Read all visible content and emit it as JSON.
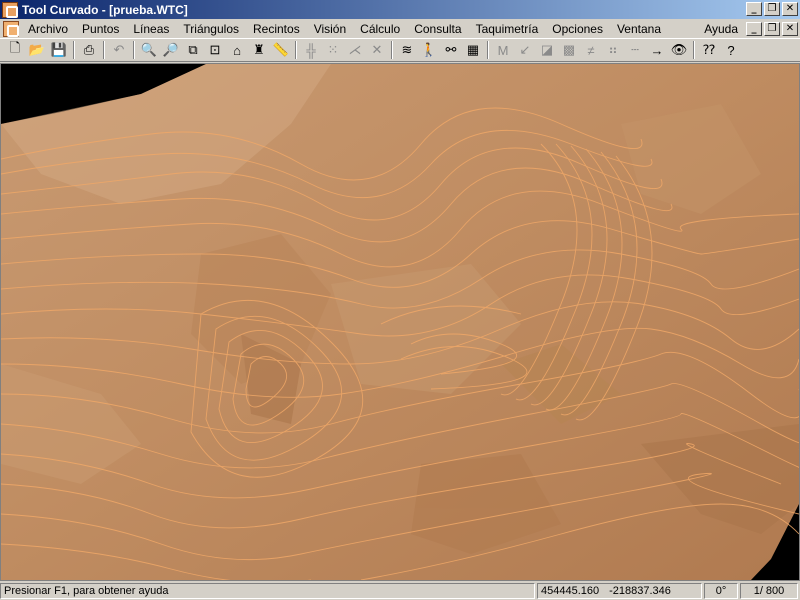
{
  "window": {
    "title": "Tool Curvado - [prueba.WTC]"
  },
  "menu": {
    "items": [
      "Archivo",
      "Puntos",
      "Líneas",
      "Triángulos",
      "Recintos",
      "Visión",
      "Cálculo",
      "Consulta",
      "Taquimetría",
      "Opciones",
      "Ventana"
    ],
    "help": "Ayuda"
  },
  "toolbar": {
    "icons": [
      "new-icon",
      "open-icon",
      "save-icon",
      "print-icon",
      "undo-icon",
      "zoom-in-icon",
      "zoom-out-icon",
      "zoom-window-icon",
      "zoom-extents-icon",
      "house-icon",
      "brush-icon",
      "measure-icon",
      "grid-icon",
      "dot-grid-icon",
      "triangle-icon",
      "cross-icon",
      "contour-icon",
      "walker-icon",
      "binoculars-icon",
      "color-map-icon",
      "m-icon",
      "point-add-icon",
      "point-edit-icon",
      "mesh-icon",
      "label-icon",
      "point-pair-icon",
      "dash-line-icon",
      "arrow-right-icon",
      "eye-icon",
      "context-help-icon",
      "help-icon"
    ]
  },
  "status": {
    "help_text": "Presionar F1, para obtener ayuda",
    "x": "454445.160",
    "y": "-218837.346",
    "angle": "0°",
    "scale": "1/ 800"
  }
}
